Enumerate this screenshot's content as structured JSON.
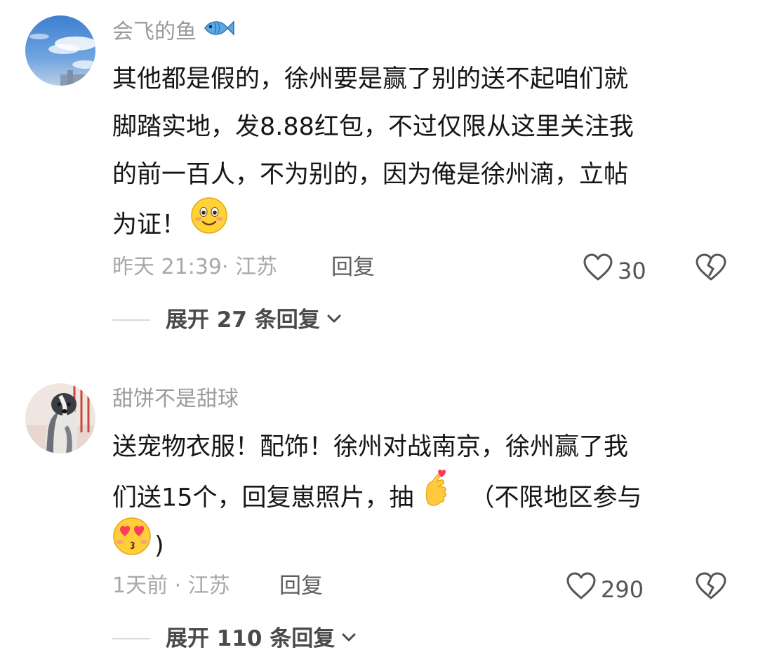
{
  "comments": [
    {
      "username": "会飞的鱼",
      "username_icon": "fish-icon",
      "avatar": "sky-clouds-avatar",
      "content_lines": [
        "其他都是假的，徐州要是赢了别的送不起咱们就",
        "脚踏实地，发8.88红包，不过仅限从这里关注我",
        "的前一百人，不为别的，因为俺是徐州滴，立帖",
        "为证！"
      ],
      "content_emojis": [
        "smiling-face-emoji"
      ],
      "timestamp": "昨天 21:39",
      "location": "· 江苏",
      "reply_label": "回复",
      "likes": "30",
      "expand_label": "展开 27 条回复"
    },
    {
      "username": "甜饼不是甜球",
      "avatar": "dog-avatar",
      "content_lines": [
        "送宠物衣服！配饰！徐州对战南京，徐州赢了我",
        "们送15个，回复崽照片，抽",
        "（不限地区参与",
        ")"
      ],
      "content_emojis": [
        "finger-heart-emoji",
        "heart-eyes-kiss-emoji"
      ],
      "timestamp": "1天前",
      "location": "· 江苏",
      "reply_label": "回复",
      "likes": "290",
      "expand_label": "展开 110 条回复"
    }
  ],
  "colors": {
    "username": "#9b9b9b",
    "text": "#161616",
    "meta": "#a8a8a8",
    "icon": "#555555"
  }
}
